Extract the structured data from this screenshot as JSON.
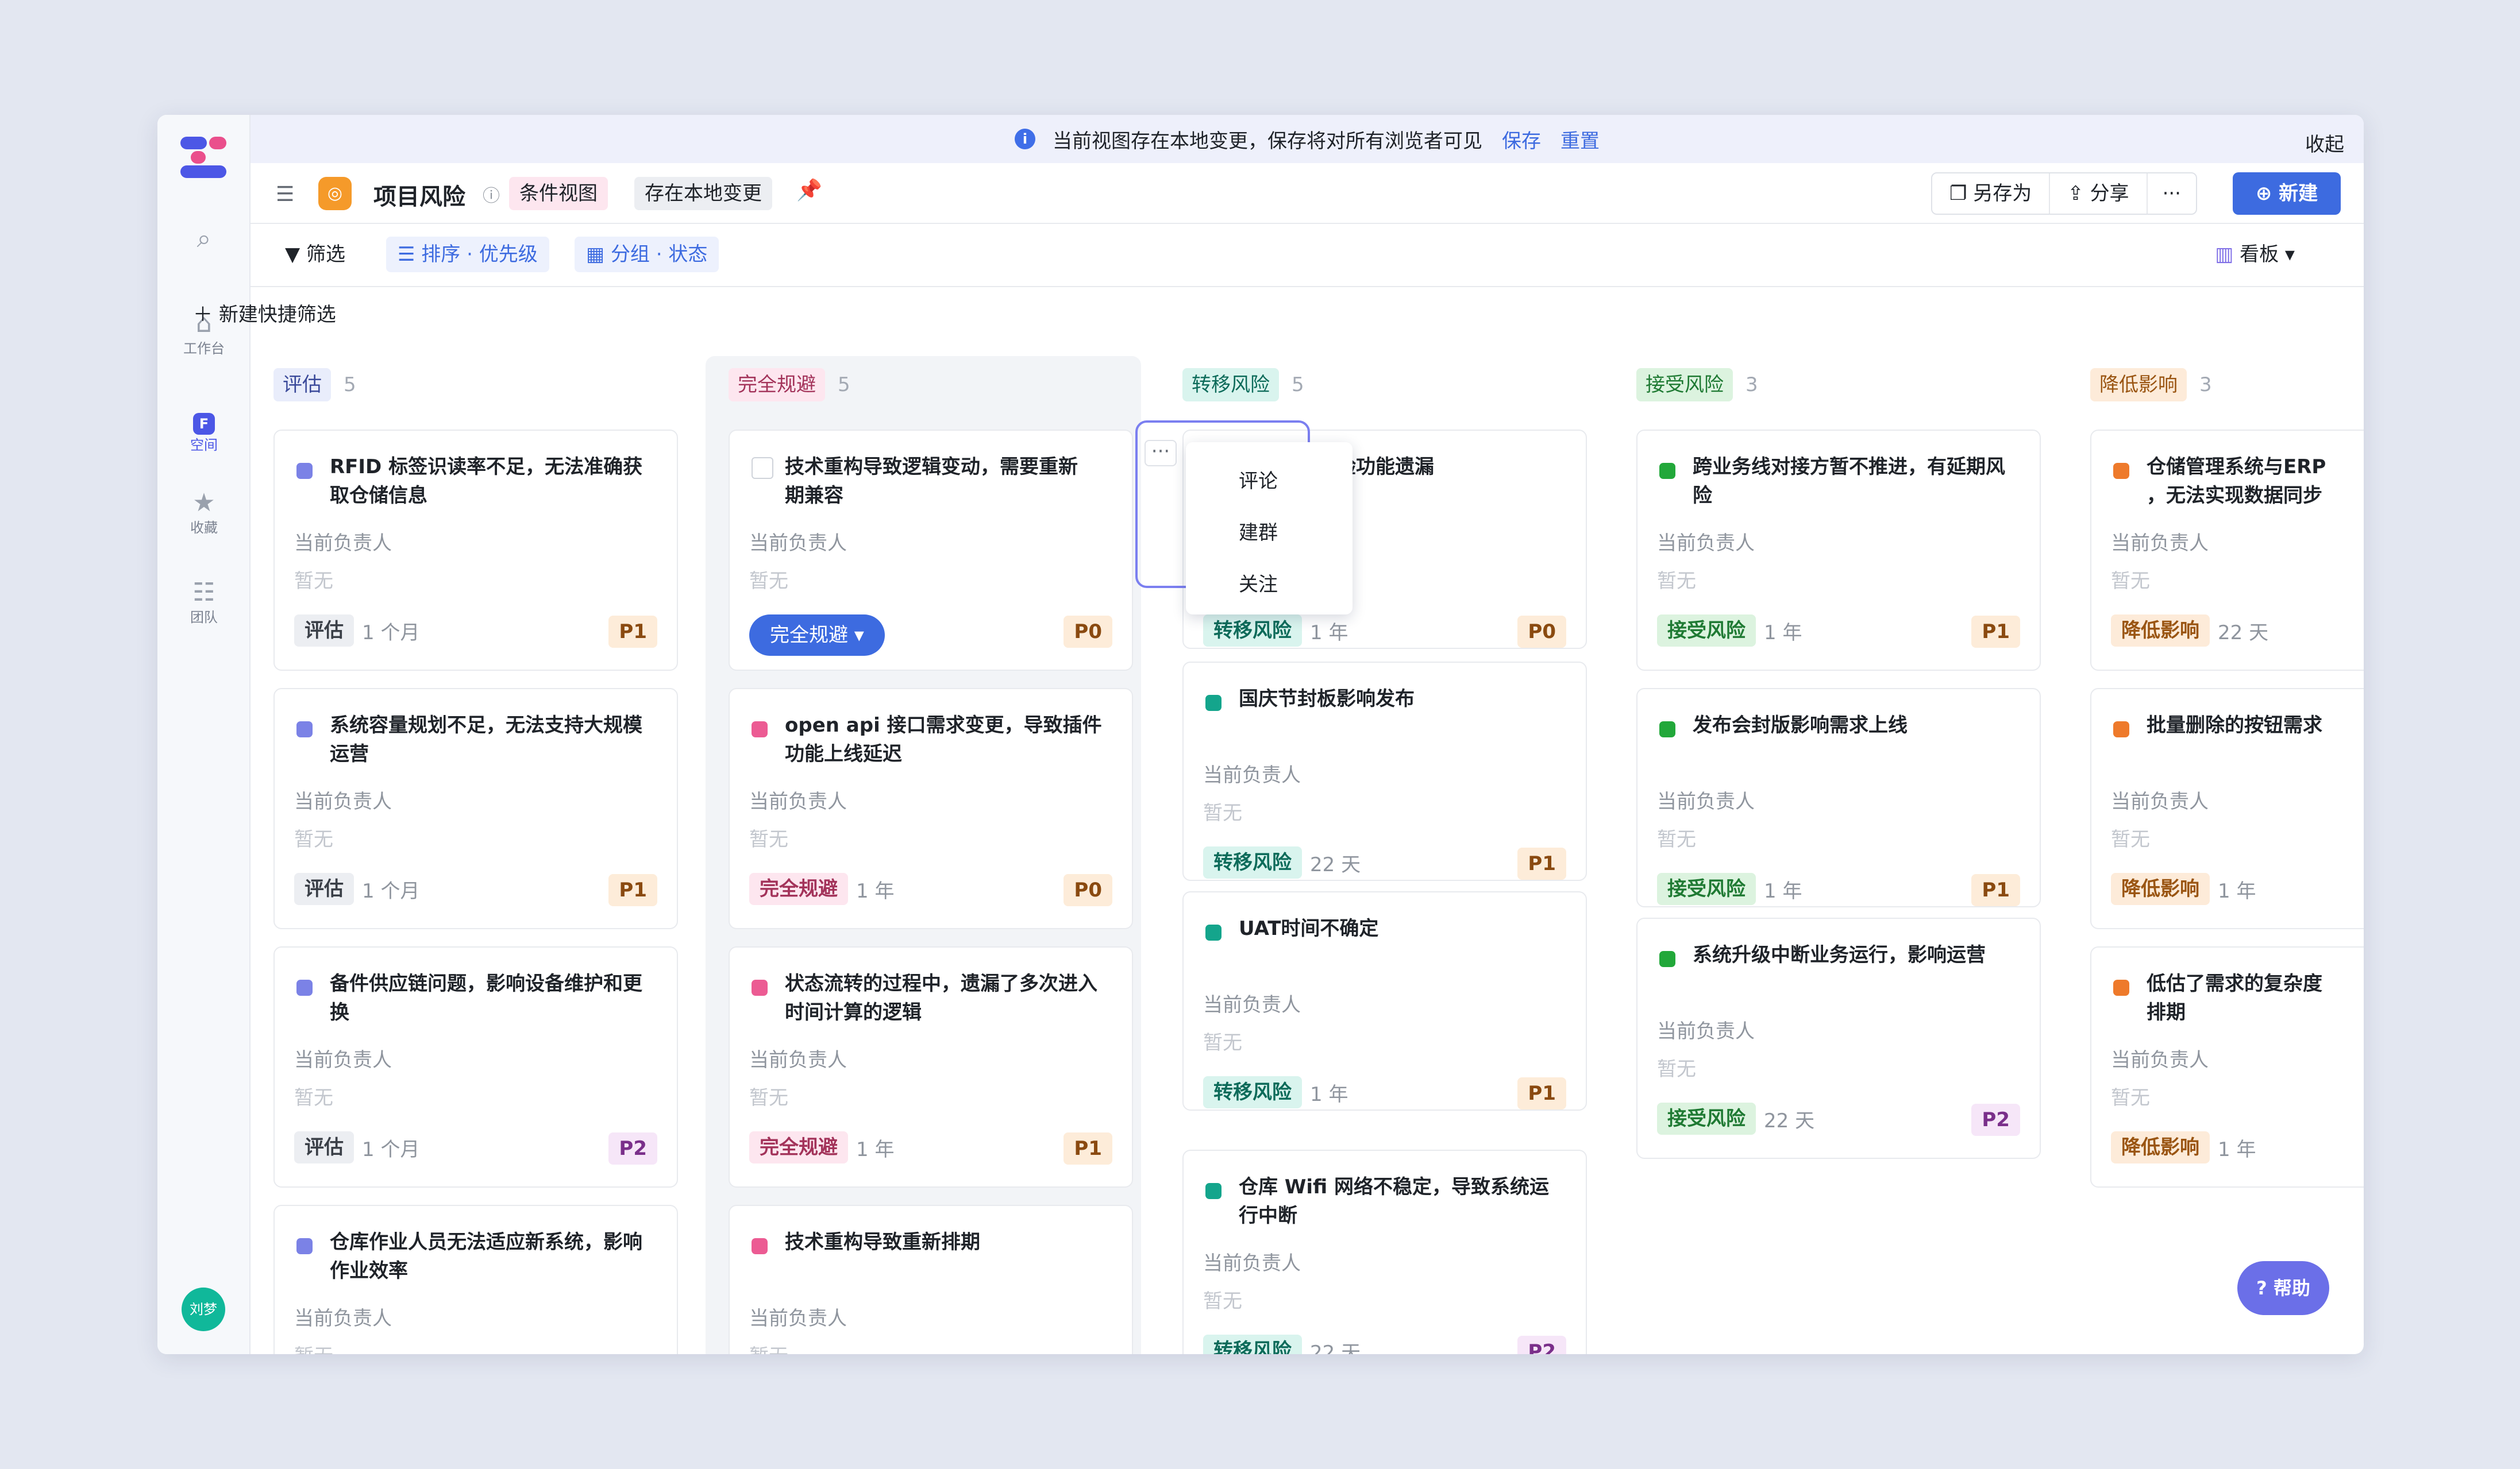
{
  "banner": {
    "text": "当前视图存在本地变更，保存将对所有浏览者可见",
    "save": "保存",
    "reset": "重置",
    "collapse": "收起"
  },
  "rail": [
    {
      "icon": "search-icon",
      "label": ""
    },
    {
      "icon": "home-icon",
      "label": "工作台"
    },
    {
      "icon": "space-icon",
      "label": "空间"
    },
    {
      "icon": "star-icon",
      "label": "收藏"
    },
    {
      "icon": "team-icon",
      "label": "团队"
    }
  ],
  "user": {
    "name": "刘梦"
  },
  "header": {
    "title": "项目风险",
    "view_tag": "条件视图",
    "local_tag": "存在本地变更",
    "saveas": "另存为",
    "share": "分享",
    "more": "···",
    "new": "新建"
  },
  "toolbar": {
    "filter": "筛选",
    "sort": "排序 · 优先级",
    "group": "分组 · 状态",
    "view": "看板"
  },
  "quick_filter": "新建快捷筛选",
  "owner_label": "当前负责人",
  "none_label": "暂无",
  "columns": [
    {
      "name": "评估",
      "count": "5",
      "tag_bg": "#e9edfb",
      "tag_fg": "#3b4a9a",
      "dot": "#7b82e6",
      "cards": [
        {
          "title": "RFID 标签识读率不足，无法准确获\n取仓储信息",
          "status": "评估",
          "dur": "1 个月",
          "pri": "P1"
        },
        {
          "title": "系统容量规划不足，无法支持大规模\n运营",
          "status": "评估",
          "dur": "1 个月",
          "pri": "P1"
        },
        {
          "title": "备件供应链问题，影响设备维护和更\n换",
          "status": "评估",
          "dur": "1 个月",
          "pri": "P2"
        },
        {
          "title": "仓库作业人员无法适应新系统，影响\n作业效率",
          "status": "评估",
          "dur": "",
          "pri": ""
        }
      ]
    },
    {
      "name": "完全规避",
      "count": "5",
      "tag_bg": "#fde6ef",
      "tag_fg": "#a3335a",
      "dot": "#ec5b93",
      "cards": [
        {
          "title": "技术重构导致逻辑变动，需要重新\n期兼容",
          "status": "完全规避",
          "dur": "",
          "pri": "P0"
        },
        {
          "title": "open api 接口需求变更，导致插件\n功能上线延迟",
          "status": "完全规避",
          "dur": "1 年",
          "pri": "P0"
        },
        {
          "title": "状态流转的过程中，遗漏了多次进入\n时间计算的逻辑",
          "status": "完全规避",
          "dur": "1 年",
          "pri": "P1"
        },
        {
          "title": "技术重构导致重新排期",
          "status": "",
          "dur": "",
          "pri": ""
        }
      ]
    },
    {
      "name": "转移风险",
      "count": "5",
      "tag_bg": "#d9f4ee",
      "tag_fg": "#0d6b5a",
      "dot": "#14a58c",
      "cards": [
        {
          "title": "测试用例检验功能遗漏",
          "status": "转移风险",
          "dur": "1 年",
          "pri": "P0"
        },
        {
          "title": "国庆节封板影响发布",
          "status": "转移风险",
          "dur": "22 天",
          "pri": "P1"
        },
        {
          "title": "UAT时间不确定",
          "status": "转移风险",
          "dur": "1 年",
          "pri": "P1"
        },
        {
          "title": "仓库 Wifi 网络不稳定，导致系统运\n行中断",
          "status": "转移风险",
          "dur": "22 天",
          "pri": "P2"
        }
      ]
    },
    {
      "name": "接受风险",
      "count": "3",
      "tag_bg": "#dcf3df",
      "tag_fg": "#1f7a33",
      "dot": "#22a83a",
      "cards": [
        {
          "title": "跨业务线对接方暂不推进，有延期风\n险",
          "status": "接受风险",
          "dur": "1 年",
          "pri": "P1"
        },
        {
          "title": "发布会封版影响需求上线",
          "status": "接受风险",
          "dur": "1 年",
          "pri": "P1"
        },
        {
          "title": "系统升级中断业务运行，影响运营",
          "status": "接受风险",
          "dur": "22 天",
          "pri": "P2"
        }
      ]
    },
    {
      "name": "降低影响",
      "count": "3",
      "tag_bg": "#fdebd9",
      "tag_fg": "#9a5512",
      "dot": "#ee7a2b",
      "cards": [
        {
          "title": "仓储管理系统与ERP\n，无法实现数据同步",
          "status": "降低影响",
          "dur": "22 天",
          "pri": ""
        },
        {
          "title": "批量删除的按钮需求",
          "status": "降低影响",
          "dur": "1 年",
          "pri": ""
        },
        {
          "title": "低估了需求的复杂度\n排期",
          "status": "降低影响",
          "dur": "1 年",
          "pri": ""
        }
      ]
    }
  ],
  "priority_colors": {
    "P0": {
      "bg": "#fdecd9",
      "fg": "#8a4a10"
    },
    "P1": {
      "bg": "#fdecd9",
      "fg": "#8a4a10"
    },
    "P2": {
      "bg": "#f6e6f8",
      "fg": "#7a2f8a"
    }
  },
  "context_menu": {
    "items": [
      "评论",
      "建群",
      "关注"
    ],
    "more": "···"
  },
  "help": "帮助"
}
